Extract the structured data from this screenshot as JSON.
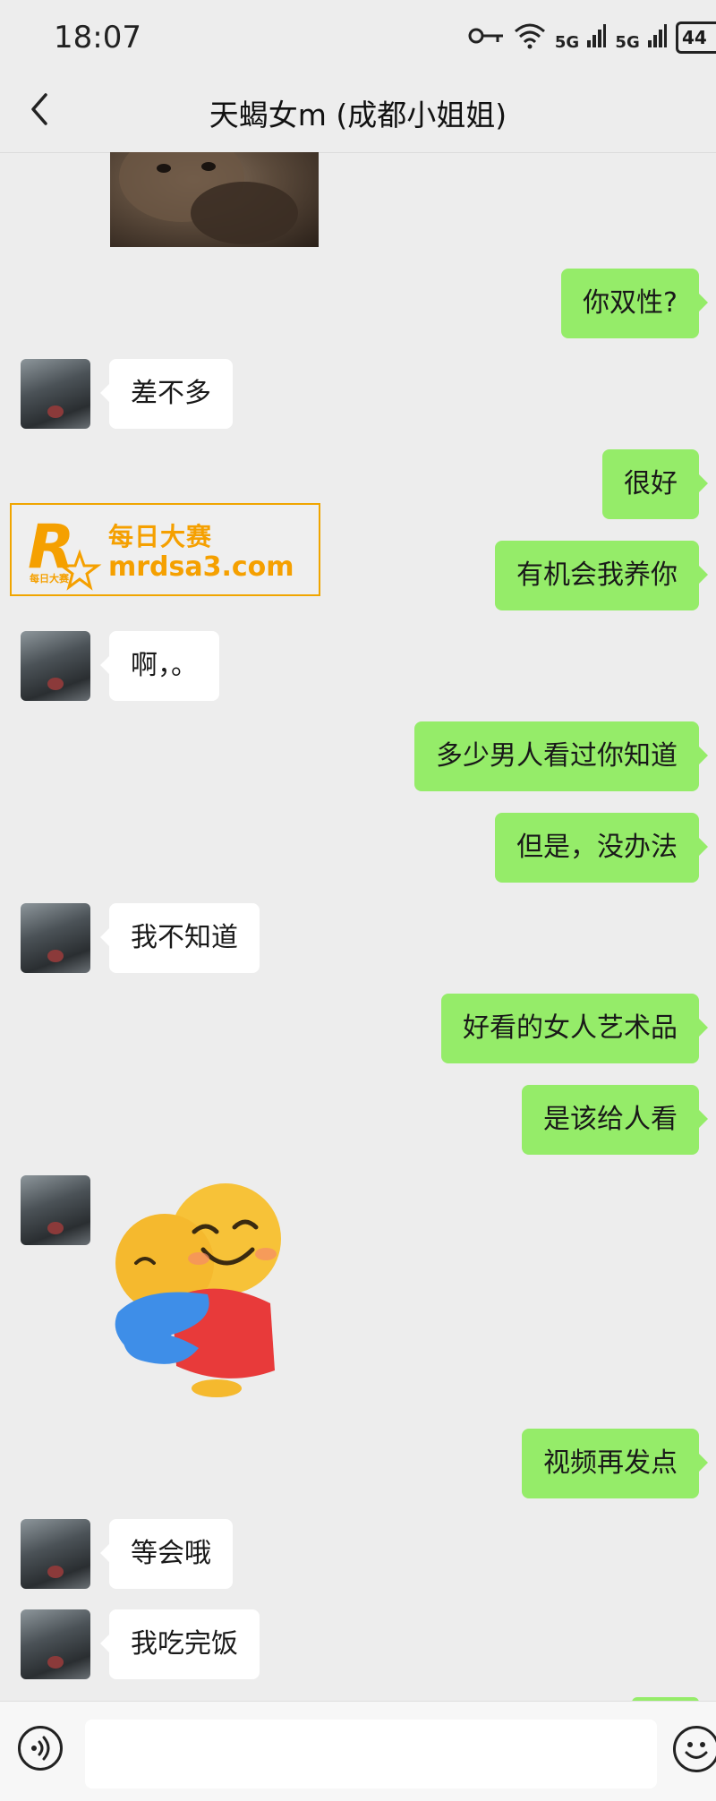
{
  "status_bar": {
    "time": "18:07",
    "signal1": "5G",
    "signal2": "5G",
    "battery": "44",
    "icons": [
      "key-icon",
      "wifi-icon",
      "signal-icon",
      "signal-icon",
      "battery-icon"
    ]
  },
  "header": {
    "title": "天蝎女m (成都小姐姐)",
    "back_icon": "chevron-left-icon"
  },
  "messages": [
    {
      "type": "image",
      "from": "contact",
      "content": "cat-photo"
    },
    {
      "type": "text",
      "from": "me",
      "text": "你双性?"
    },
    {
      "type": "text",
      "from": "contact",
      "text": "差不多"
    },
    {
      "type": "text",
      "from": "me",
      "text": "很好"
    },
    {
      "type": "text",
      "from": "me",
      "text": "有机会我养你"
    },
    {
      "type": "text",
      "from": "contact",
      "text": "啊，。"
    },
    {
      "type": "text",
      "from": "me",
      "text": "多少男人看过你知道"
    },
    {
      "type": "text",
      "from": "me",
      "text": "但是，没办法"
    },
    {
      "type": "text",
      "from": "contact",
      "text": "我不知道"
    },
    {
      "type": "text",
      "from": "me",
      "text": "好看的女人艺术品"
    },
    {
      "type": "text",
      "from": "me",
      "text": "是该给人看"
    },
    {
      "type": "sticker",
      "from": "contact",
      "content": "hug-emoji"
    },
    {
      "type": "text",
      "from": "me",
      "text": "视频再发点"
    },
    {
      "type": "text",
      "from": "contact",
      "text": "等会哦"
    },
    {
      "type": "text",
      "from": "contact",
      "text": "我吃完饭"
    }
  ],
  "watermark": {
    "logo_letter": "R",
    "logo_small": "每日大赛",
    "line1": "每日大赛",
    "line2": "mrdsa3.com"
  },
  "input_bar": {
    "voice_icon": "voice-icon",
    "emoji_icon": "emoji-icon",
    "input_value": ""
  },
  "colors": {
    "background": "#ededed",
    "outgoing_bubble": "#95ec69",
    "incoming_bubble": "#ffffff",
    "watermark": "#f5a000"
  }
}
